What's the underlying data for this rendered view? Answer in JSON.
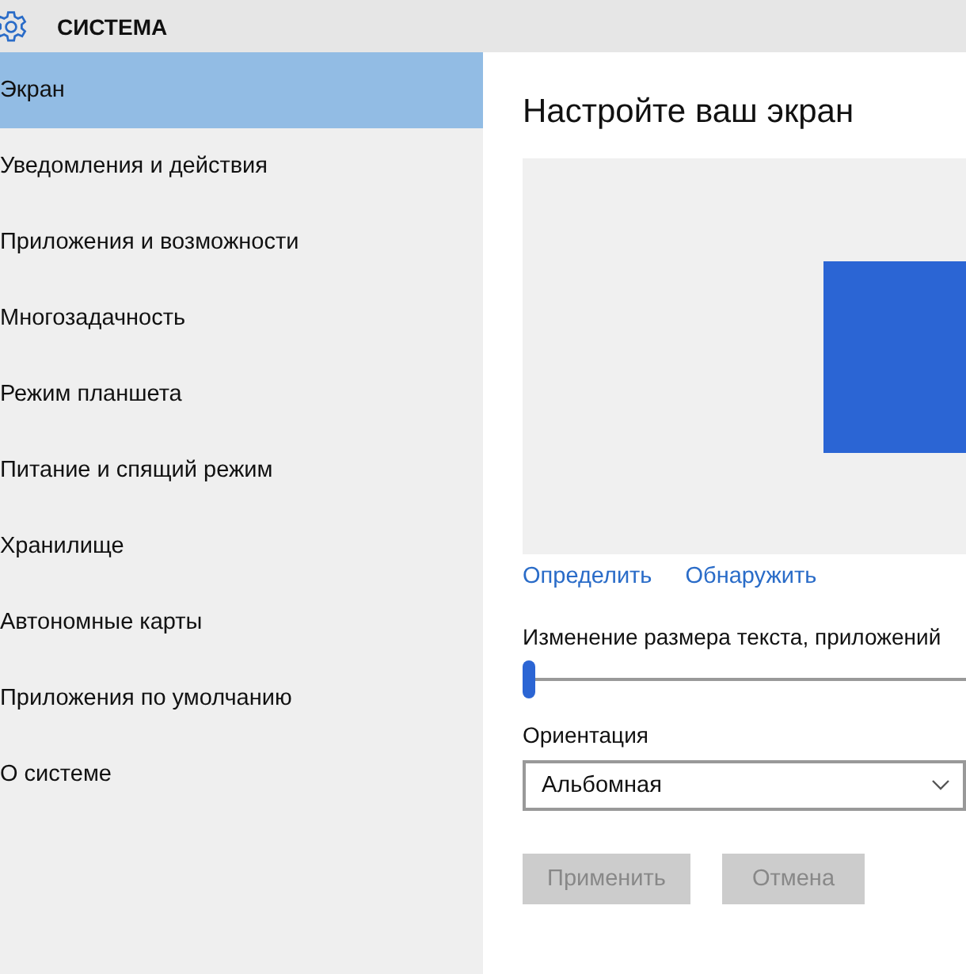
{
  "header": {
    "title": "СИСТЕМА"
  },
  "sidebar": {
    "items": [
      {
        "label": "Экран",
        "selected": true
      },
      {
        "label": "Уведомления и действия",
        "selected": false
      },
      {
        "label": "Приложения и возможности",
        "selected": false
      },
      {
        "label": "Многозадачность",
        "selected": false
      },
      {
        "label": "Режим планшета",
        "selected": false
      },
      {
        "label": "Питание и спящий режим",
        "selected": false
      },
      {
        "label": "Хранилище",
        "selected": false
      },
      {
        "label": "Автономные карты",
        "selected": false
      },
      {
        "label": "Приложения по умолчанию",
        "selected": false
      },
      {
        "label": "О системе",
        "selected": false
      }
    ]
  },
  "main": {
    "title": "Настройте ваш экран",
    "links": [
      "Определить",
      "Обнаружить"
    ],
    "scale": {
      "label": "Изменение размера текста, приложений",
      "level": 0
    },
    "orientation": {
      "label": "Ориентация",
      "value": "Альбомная"
    },
    "buttons": [
      {
        "label": "Применить",
        "disabled": true
      },
      {
        "label": "Отмена",
        "disabled": true
      }
    ]
  }
}
